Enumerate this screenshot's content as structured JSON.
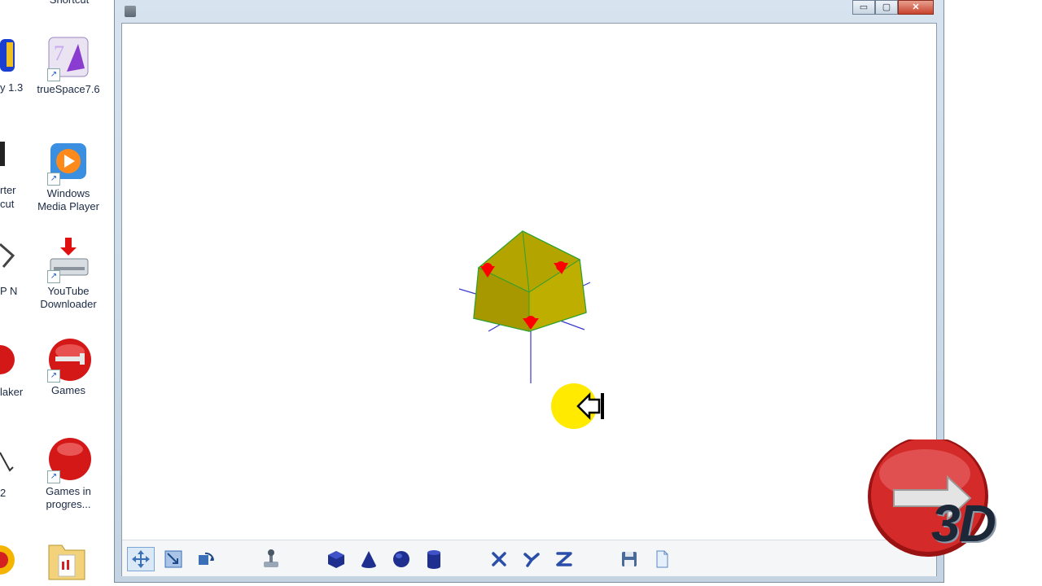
{
  "desktop": {
    "icons": [
      {
        "label_lines": [
          "Shortcut"
        ],
        "icon": "shortcut-icon"
      },
      {
        "label_lines": [
          "trueSpace7.6"
        ],
        "icon": "truespace-icon"
      },
      {
        "label_lines": [
          "Windows",
          "Media Player"
        ],
        "icon": "windows-media-player-icon"
      },
      {
        "label_lines": [
          "YouTube",
          "Downloader"
        ],
        "icon": "youtube-downloader-icon"
      },
      {
        "label_lines": [
          "Games"
        ],
        "icon": "games-folder-icon"
      },
      {
        "label_lines": [
          "Games in",
          "progres..."
        ],
        "icon": "games-in-progress-icon"
      },
      {
        "label_lines": [
          ""
        ],
        "icon": "folder-icon"
      }
    ],
    "partial_labels": [
      "y 1.3",
      "rter",
      "cut",
      "P N",
      "laker",
      "2"
    ]
  },
  "window": {
    "controls": {
      "minimize": "▭",
      "maximize": "▢",
      "close": "✕"
    }
  },
  "viewport": {
    "object": "cube",
    "object_color": "#c8b800",
    "edge_color": "#2fa02f",
    "axis_color": "#3a3ad0",
    "handle_color": "#ff0000",
    "cursor_highlight": "#ffea00"
  },
  "toolbar": {
    "tools": [
      {
        "name": "move-tool",
        "active": true
      },
      {
        "name": "scale-tool",
        "active": false
      },
      {
        "name": "rotate-tool",
        "active": false
      },
      {
        "name": "render-tool",
        "active": false
      },
      {
        "name": "cube-primitive",
        "active": false
      },
      {
        "name": "cone-primitive",
        "active": false
      },
      {
        "name": "sphere-primitive",
        "active": false
      },
      {
        "name": "cylinder-primitive",
        "active": false
      },
      {
        "name": "axis-x",
        "active": false
      },
      {
        "name": "axis-y",
        "active": false
      },
      {
        "name": "axis-z",
        "active": false
      },
      {
        "name": "save",
        "active": false
      },
      {
        "name": "new-document",
        "active": false
      }
    ]
  },
  "badge": {
    "text": "3D",
    "color": "#d42a2a"
  }
}
